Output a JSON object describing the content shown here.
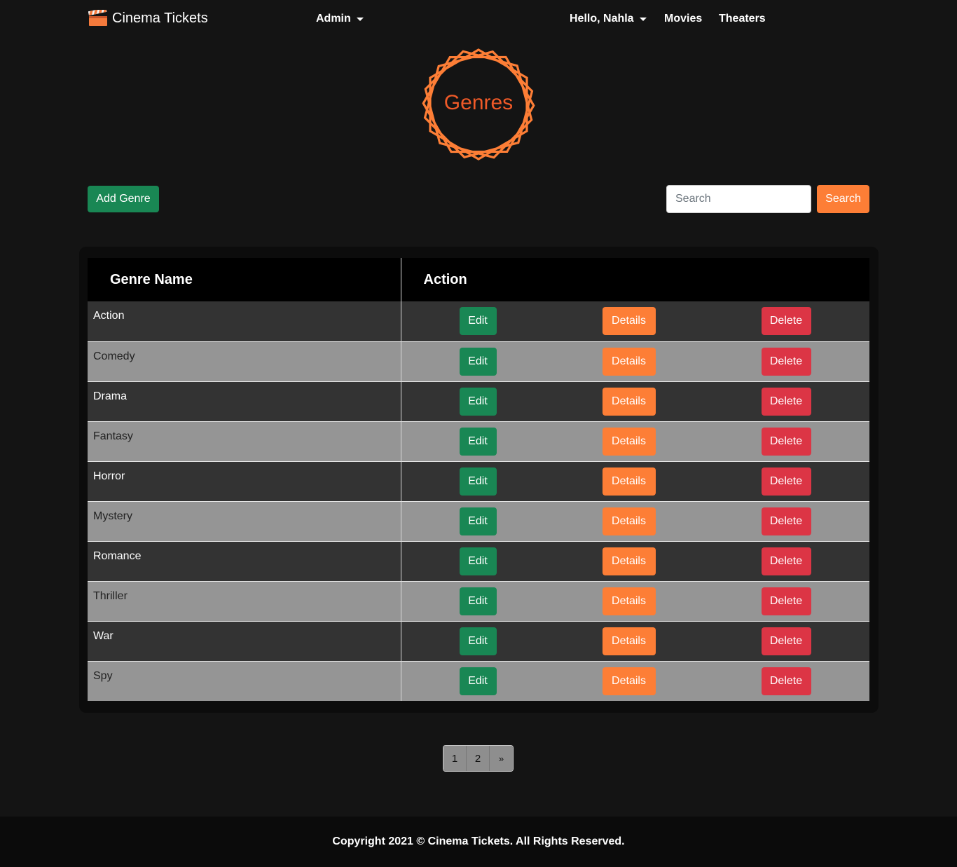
{
  "nav": {
    "brand": "Cinema Tickets",
    "brand_icon": "clapperboard-icon",
    "admin": "Admin",
    "greeting": "Hello, Nahla",
    "movies": "Movies",
    "theaters": "Theaters"
  },
  "logo": {
    "text": "Genres",
    "color": "#f05a28",
    "ring_color": "#fd7e36"
  },
  "toolbar": {
    "add_label": "Add Genre",
    "search_placeholder": "Search",
    "search_value": "",
    "search_label": "Search"
  },
  "table": {
    "headers": {
      "name": "Genre Name",
      "action": "Action"
    },
    "edit_label": "Edit",
    "details_label": "Details",
    "delete_label": "Delete",
    "rows": [
      "Action",
      "Comedy",
      "Drama",
      "Fantasy",
      "Horror",
      "Mystery",
      "Romance",
      "Thriller",
      "War",
      "Spy"
    ]
  },
  "pagination": {
    "pages": [
      "1",
      "2"
    ],
    "next": "»"
  },
  "footer": {
    "text": "Copyright 2021 © Cinema Tickets. All Rights Reserved."
  },
  "colors": {
    "green": "#198754",
    "orange": "#fd7e36",
    "red": "#dc3545",
    "background": "#141414"
  }
}
